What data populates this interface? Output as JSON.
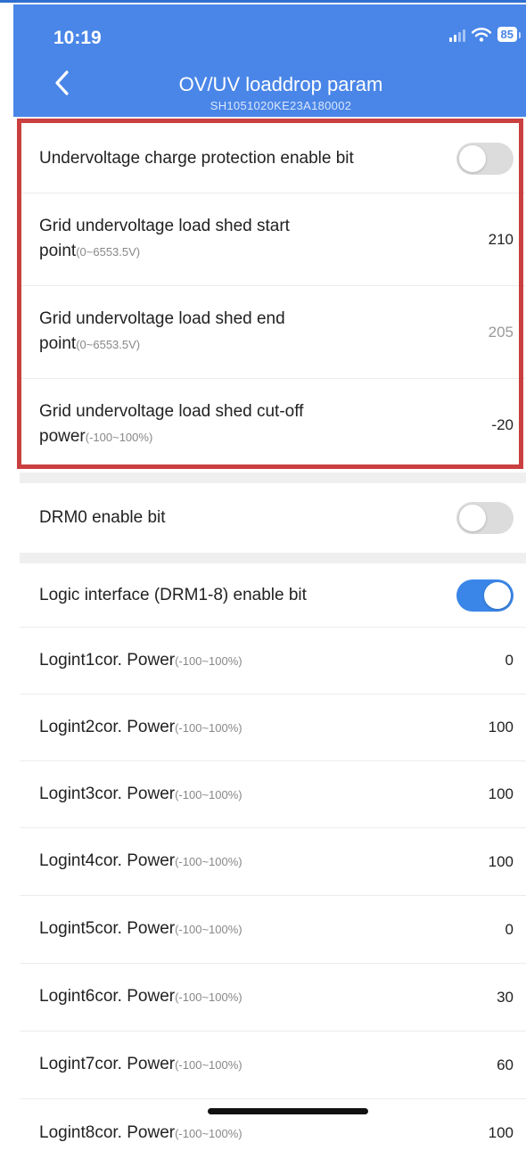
{
  "status": {
    "time": "10:19",
    "battery": "85"
  },
  "header": {
    "title": "OV/UV loaddrop param",
    "subtitle": "SH1051020KE23A180002"
  },
  "group1": {
    "undervoltage_toggle": {
      "label": "Undervoltage charge protection enable bit",
      "enabled": false
    },
    "start_point": {
      "label": "Grid undervoltage load shed start point",
      "range": "(0~6553.5V)",
      "value": "210"
    },
    "end_point": {
      "label": "Grid undervoltage load shed end point",
      "range": "(0~6553.5V)",
      "value": "205"
    },
    "cutoff_power": {
      "label": "Grid undervoltage load shed cut-off power",
      "range": "(-100~100%)",
      "value": "-20"
    }
  },
  "group2": {
    "drm0_toggle": {
      "label": "DRM0 enable bit",
      "enabled": false
    }
  },
  "group3": {
    "logic_toggle": {
      "label": "Logic interface (DRM1-8) enable bit",
      "enabled": true
    },
    "logints": [
      {
        "label": "Logint1cor. Power",
        "range": "(-100~100%)",
        "value": "0"
      },
      {
        "label": "Logint2cor. Power",
        "range": "(-100~100%)",
        "value": "100"
      },
      {
        "label": "Logint3cor. Power",
        "range": "(-100~100%)",
        "value": "100"
      },
      {
        "label": "Logint4cor. Power",
        "range": "(-100~100%)",
        "value": "100"
      },
      {
        "label": "Logint5cor. Power",
        "range": "(-100~100%)",
        "value": "0"
      },
      {
        "label": "Logint6cor. Power",
        "range": "(-100~100%)",
        "value": "30"
      },
      {
        "label": "Logint7cor. Power",
        "range": "(-100~100%)",
        "value": "60"
      },
      {
        "label": "Logint8cor. Power",
        "range": "(-100~100%)",
        "value": "100"
      }
    ]
  },
  "icons": {
    "back": "chevron-left-icon",
    "signal": "signal-icon",
    "wifi": "wifi-icon"
  },
  "colors": {
    "header": "#4a86e8",
    "toggle_on": "#3a86e8",
    "highlight": "#c9403f"
  }
}
